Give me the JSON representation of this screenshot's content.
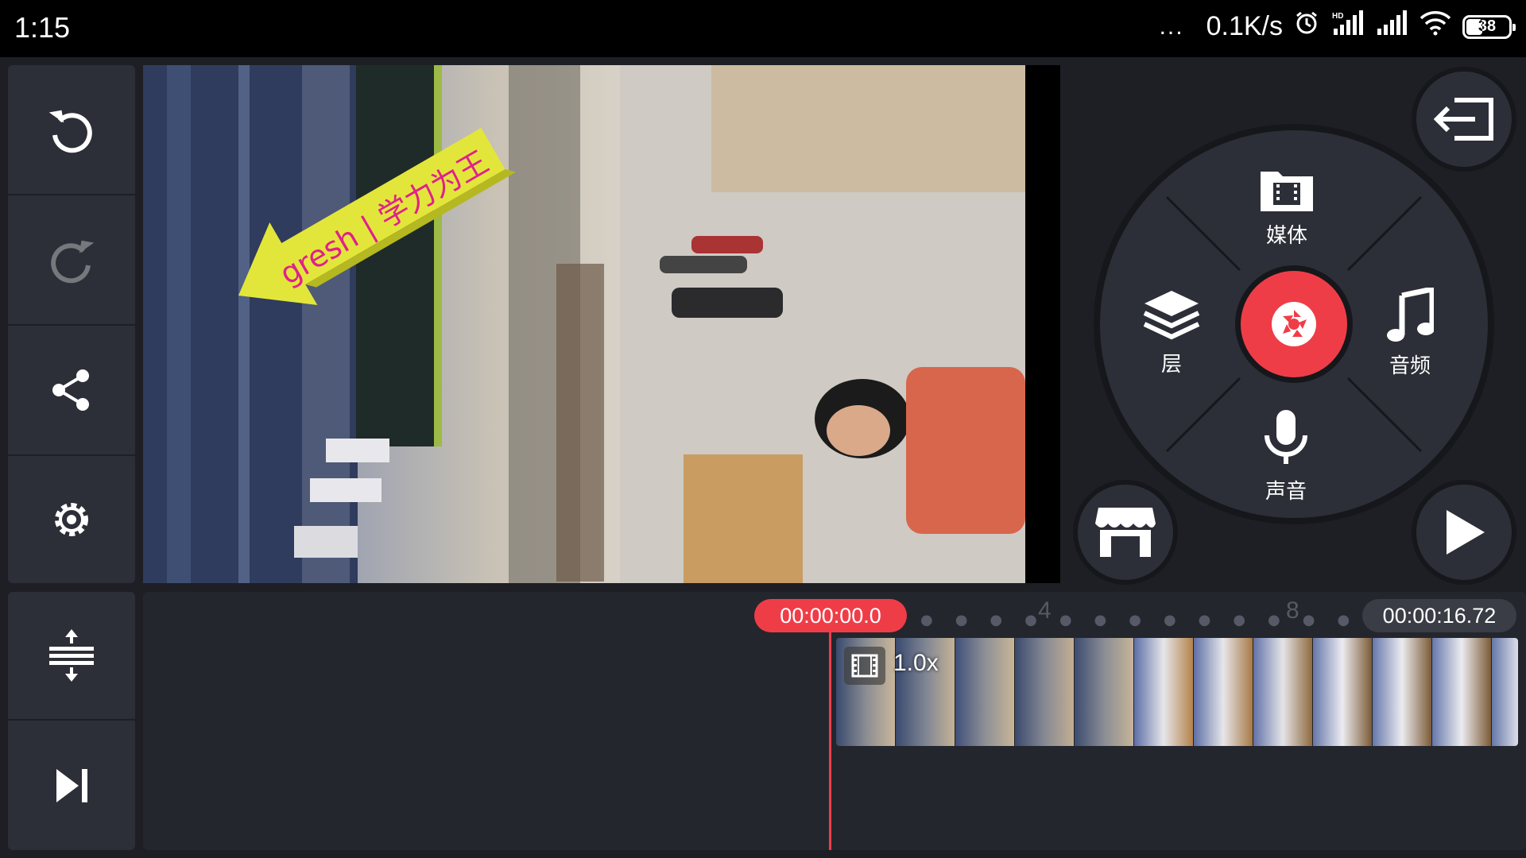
{
  "status_bar": {
    "time": "1:15",
    "dots": "...",
    "network_speed": "0.1K/s",
    "battery_level": "38",
    "hd_label": "HD"
  },
  "left_toolbar": {
    "icons": [
      "undo-icon",
      "redo-icon",
      "share-icon",
      "settings-icon"
    ],
    "bottom_icons": [
      "expand-timeline-icon",
      "skip-to-end-icon"
    ]
  },
  "watermark": {
    "text": "gresh | 学力为王",
    "arrow_color": "#e3e63a",
    "text_color": "#e0208c"
  },
  "right_controls": {
    "exit_icon": "exit-project-icon",
    "store_icon": "asset-store-icon",
    "play_icon": "play-icon",
    "wheel": {
      "media_label": "媒体",
      "layer_label": "层",
      "audio_label": "音频",
      "voice_label": "声音",
      "record_icon": "camera-shutter-icon"
    }
  },
  "timeline": {
    "current_time": "00:00:00.0",
    "total_time": "00:00:16.72",
    "tick_4": "4",
    "tick_8": "8",
    "clip_speed": "1.0x"
  },
  "colors": {
    "accent": "#ef3d48",
    "panel": "#2c2f37",
    "background": "#1d1f25"
  }
}
